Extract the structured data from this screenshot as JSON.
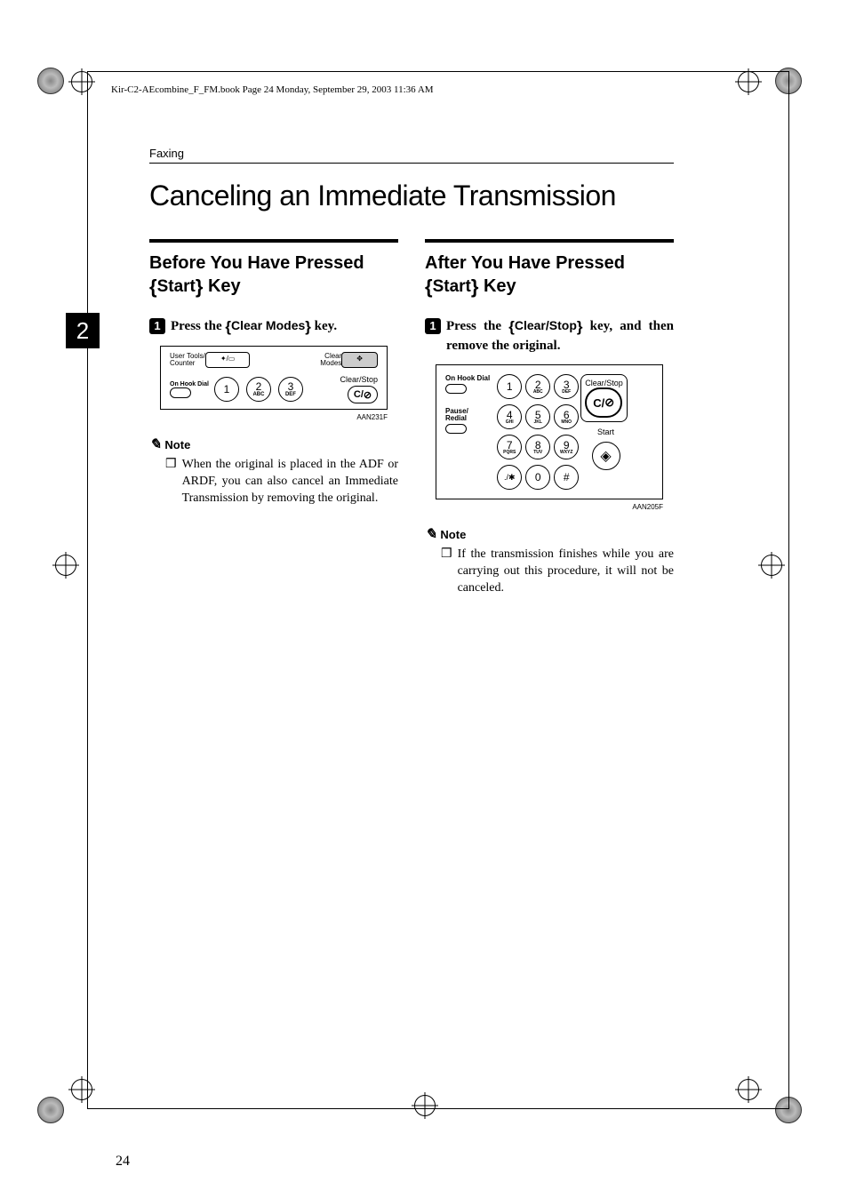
{
  "book_info": "Kir-C2-AEcombine_F_FM.book  Page 24  Monday, September 29, 2003  11:36 AM",
  "section": "Faxing",
  "title": "Canceling an Immediate Transmission",
  "chapter_tab": "2",
  "page_number": "24",
  "left": {
    "heading_pre": "Before You Have Pressed ",
    "heading_key": "Start",
    "heading_post": " Key",
    "step_num": "1",
    "step_pre": "Press the ",
    "step_key": "Clear Modes",
    "step_post": " key.",
    "illus": {
      "user_tools": "User Tools/\nCounter",
      "clear_modes": "Clear\nModes",
      "on_hook": "On Hook Dial",
      "keys": [
        {
          "n": "1",
          "s": ""
        },
        {
          "n": "2",
          "s": "ABC"
        },
        {
          "n": "3",
          "s": "DEF"
        }
      ],
      "clear_stop": "Clear/Stop",
      "cs_sym": "C/",
      "code": "AAN231F"
    },
    "note_label": "Note",
    "note_body": "When the original is placed in the ADF or ARDF, you can also cancel an Immediate Transmission by removing the original."
  },
  "right": {
    "heading_pre": "After You Have Pressed ",
    "heading_key": "Start",
    "heading_post": " Key",
    "step_num": "1",
    "step_pre": "Press the ",
    "step_key": "Clear/Stop",
    "step_post": " key, and then remove the original.",
    "illus": {
      "on_hook": "On Hook Dial",
      "pause": "Pause/\nRedial",
      "keys": [
        {
          "n": "1",
          "s": ""
        },
        {
          "n": "2",
          "s": "ABC"
        },
        {
          "n": "3",
          "s": "DEF"
        },
        {
          "n": "4",
          "s": "GHI"
        },
        {
          "n": "5",
          "s": "JKL"
        },
        {
          "n": "6",
          "s": "MNO"
        },
        {
          "n": "7",
          "s": "PQRS"
        },
        {
          "n": "8",
          "s": "TUV"
        },
        {
          "n": "9",
          "s": "WXYZ"
        },
        {
          "n": "./✱",
          "s": ""
        },
        {
          "n": "0",
          "s": ""
        },
        {
          "n": "#",
          "s": ""
        }
      ],
      "clear_stop": "Clear/Stop",
      "cs_sym": "C/",
      "start": "Start",
      "start_sym": "◈",
      "code": "AAN205F"
    },
    "note_label": "Note",
    "note_body": "If the transmission finishes while you are carrying out this procedure, it will not be canceled."
  }
}
